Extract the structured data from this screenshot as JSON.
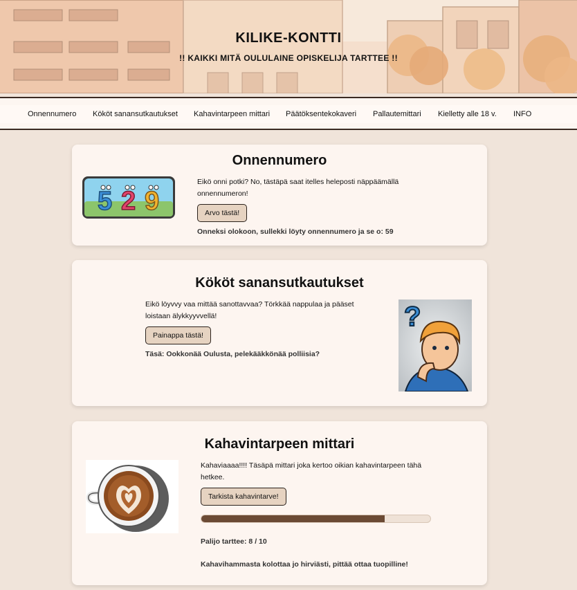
{
  "header": {
    "title": "KILIKE-KONTTI",
    "subtitle": "!! KAIKKI MITÄ OULULAINE OPISKELIJA TARTTEE !!"
  },
  "nav": {
    "items": [
      {
        "label": "Onnennumero"
      },
      {
        "label": "Kököt sanansutkautukset"
      },
      {
        "label": "Kahavintarpeen mittari"
      },
      {
        "label": "Päätöksentekokaveri"
      },
      {
        "label": "Pallautemittari"
      },
      {
        "label": "Kielletty alle 18 v."
      },
      {
        "label": "INFO"
      }
    ]
  },
  "cards": {
    "lucky": {
      "title": "Onnennumero",
      "description": "Eikö onni potki? No, tästäpä saat itelles heleposti näppäämällä onnennumeron!",
      "button_label": "Arvo tästä!",
      "result": "Onneksi olokoon, sullekki löyty onnennumero ja se o: 59",
      "image_digits": [
        "5",
        "2",
        "9"
      ]
    },
    "sayings": {
      "title": "Kököt sanansutkautukset",
      "description": "Eikö löyvvy vaa mittää sanottavvaa? Törkkää nappulaa ja pääset loistaan älykkyyvvellä!",
      "button_label": "Painappa tästä!",
      "result": "Täsä: Ookkonää Oulusta, pelekääkkönää polliisia?"
    },
    "coffee": {
      "title": "Kahavintarpeen mittari",
      "description": "Kahaviaaaa!!!! Täsäpä mittari joka kertoo oikian kahavintarpeen tähä hetkee.",
      "button_label": "Tarkista kahavintarve!",
      "meter_value": 8,
      "meter_max": 10,
      "meter_text": "Palijo tarttee: 8 / 10",
      "message": "Kahavihammasta kolottaa jo hirviästi, pittää ottaa tuopilline!"
    }
  },
  "colors": {
    "background": "#f0e4da",
    "card": "#fdf5f0",
    "button": "#e6d3c1",
    "progress_fill": "#6b4a34"
  }
}
